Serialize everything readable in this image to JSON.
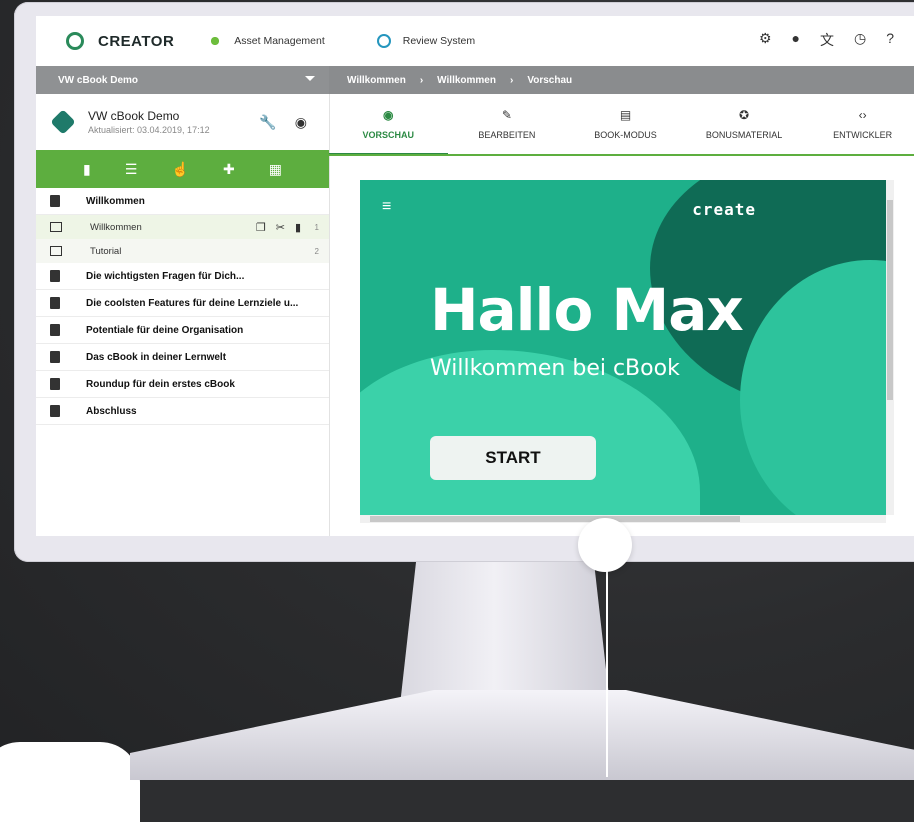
{
  "app": {
    "brand": "CREATOR",
    "topnav": [
      {
        "label": "Asset Management",
        "icon": "asset-icon"
      },
      {
        "label": "Review System",
        "icon": "review-icon"
      }
    ],
    "top_icons": [
      "settings-icon",
      "account-icon",
      "translate-icon",
      "history-icon",
      "help-icon"
    ]
  },
  "sidebar": {
    "project_select": "VW cBook Demo",
    "project": {
      "name": "VW cBook Demo",
      "updated": "Aktualisiert: 03.04.2019, 17:12"
    },
    "tools": [
      "book-icon",
      "layout-icon",
      "touch-icon",
      "puzzle-icon",
      "template-icon"
    ],
    "chapters": [
      {
        "title": "Willkommen",
        "expanded": true,
        "pages": [
          {
            "title": "Willkommen",
            "number": "1",
            "active": true
          },
          {
            "title": "Tutorial",
            "number": "2",
            "active": false
          }
        ]
      },
      {
        "title": "Die wichtigsten Fragen für Dich..."
      },
      {
        "title": "Die coolsten Features für deine Lernziele u..."
      },
      {
        "title": "Potentiale für deine Organisation"
      },
      {
        "title": "Das cBook in deiner Lernwelt"
      },
      {
        "title": "Roundup für dein erstes cBook"
      },
      {
        "title": "Abschluss"
      }
    ]
  },
  "breadcrumb": [
    "Willkommen",
    "Willkommen",
    "Vorschau"
  ],
  "tabs": [
    {
      "label": "VORSCHAU",
      "icon": "eye-icon",
      "active": true
    },
    {
      "label": "BEARBEITEN",
      "icon": "pencil-icon",
      "active": false
    },
    {
      "label": "BOOK-MODUS",
      "icon": "book-mode-icon",
      "active": false
    },
    {
      "label": "BONUSMATERIAL",
      "icon": "star-icon",
      "active": false
    },
    {
      "label": "ENTWICKLER",
      "icon": "code-icon",
      "active": false
    }
  ],
  "preview": {
    "logo": "create",
    "headline": "Hallo Max",
    "subline": "Willkommen bei cBook",
    "button": "START",
    "colors": {
      "bg": "#1eb08a",
      "dark": "#0f6b55"
    }
  },
  "colors": {
    "accent": "#5dae3f",
    "gray_bar": "#8f9193"
  }
}
